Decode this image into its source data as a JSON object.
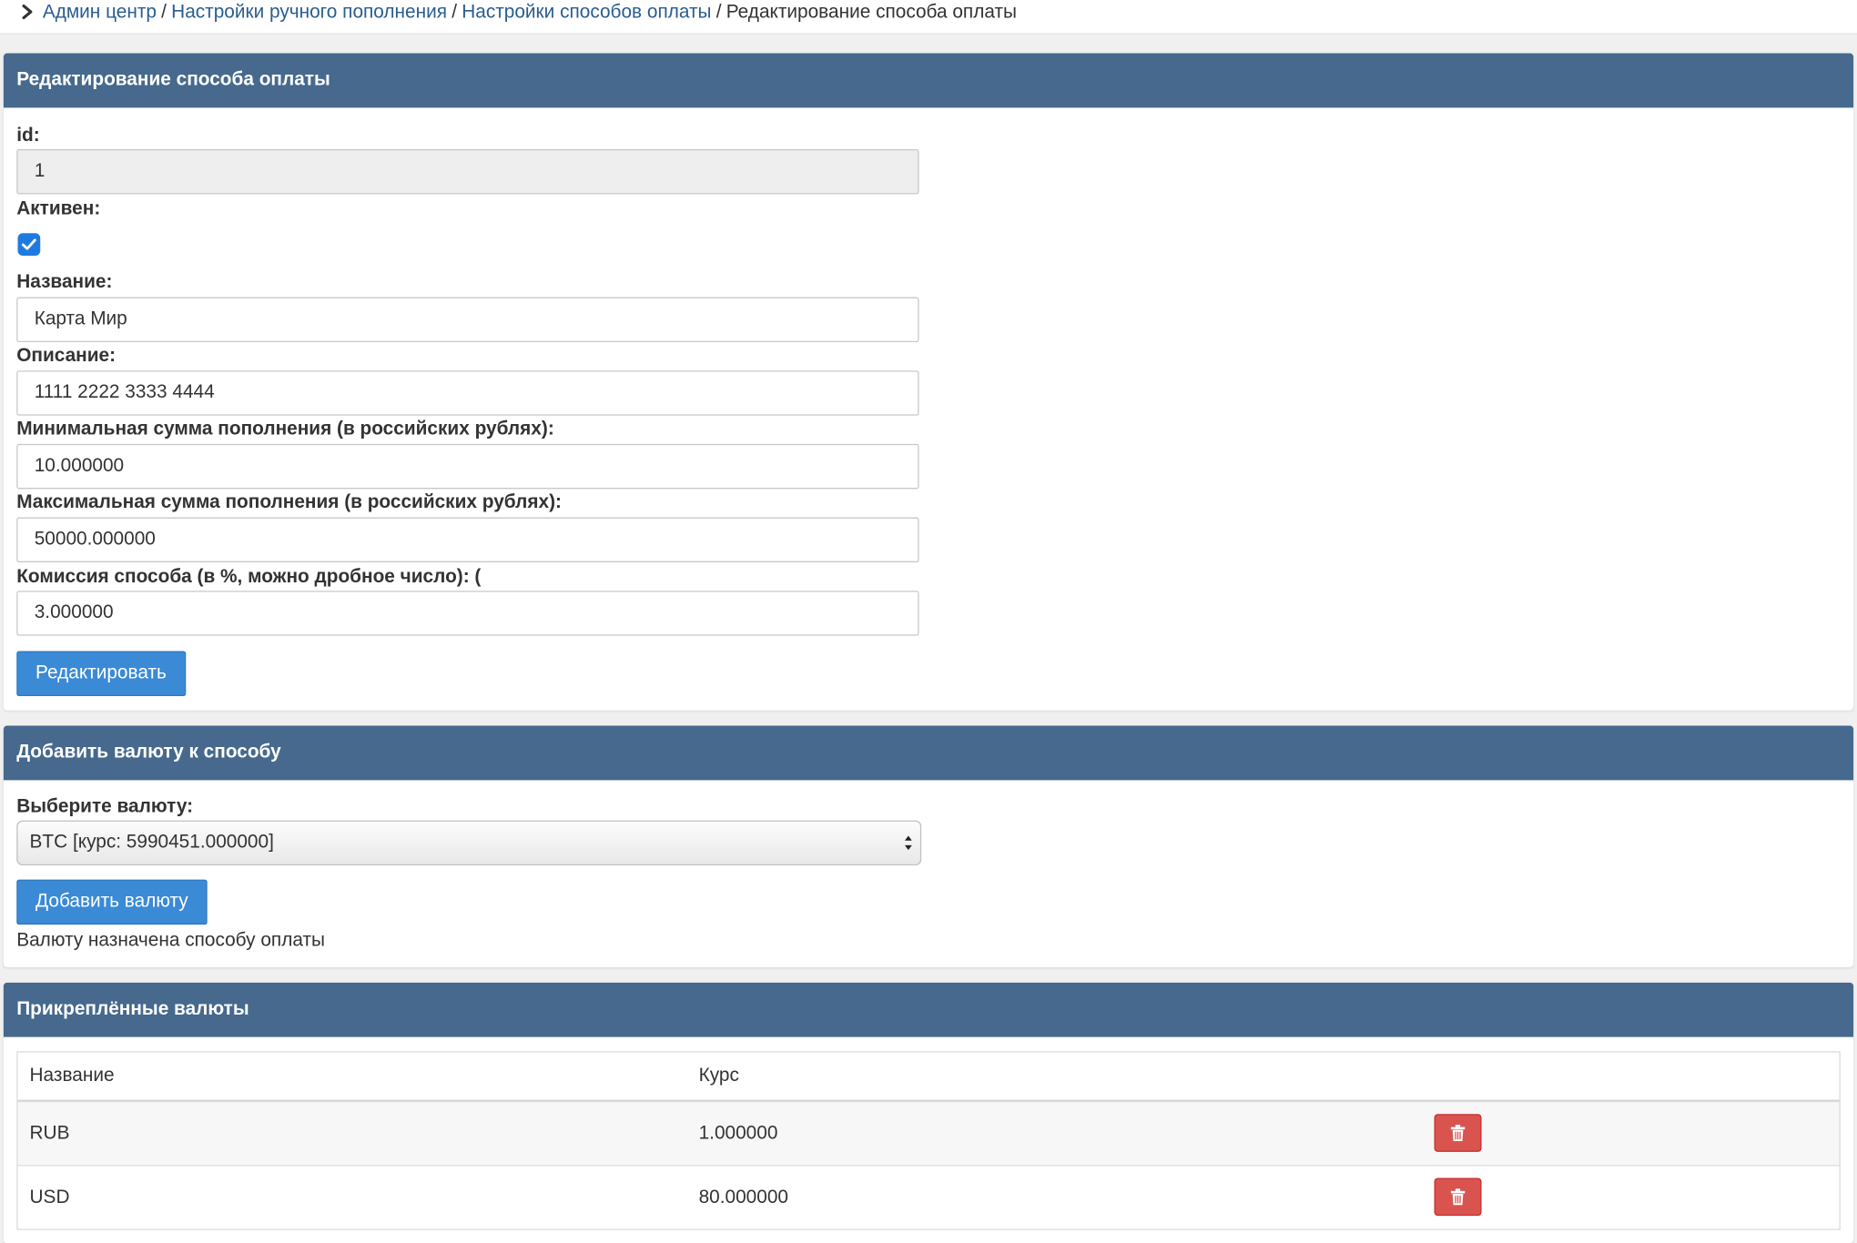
{
  "breadcrumb": {
    "items": [
      "Админ центр",
      "Настройки ручного пополнения",
      "Настройки способов оплаты"
    ],
    "separator": "/",
    "current": "Редактирование способа оплаты"
  },
  "edit_panel": {
    "title": "Редактирование способа оплаты",
    "id_label": "id:",
    "id_value": "1",
    "active_label": "Активен:",
    "active_checked": true,
    "name_label": "Название:",
    "name_value": "Карта Мир",
    "description_label": "Описание:",
    "description_value": "1111 2222 3333 4444",
    "min_label": "Минимальная сумма пополнения (в российских рублях):",
    "min_value": "10.000000",
    "max_label": "Максимальная сумма пополнения (в российских рублях):",
    "max_value": "50000.000000",
    "fee_label": "Комиссия способа (в %, можно дробное число): (",
    "fee_value": "3.000000",
    "submit_label": "Редактировать"
  },
  "add_currency_panel": {
    "title": "Добавить валюту к способу",
    "select_label": "Выберите валюту:",
    "selected_option": "BTC [курс: 5990451.000000]",
    "add_button_label": "Добавить валюту",
    "status_message": "Валюту назначена способу оплаты"
  },
  "attached_panel": {
    "title": "Прикреплённые валюты",
    "columns": [
      "Название",
      "Курс"
    ],
    "rows": [
      {
        "name": "RUB",
        "rate": "1.000000"
      },
      {
        "name": "USD",
        "rate": "80.000000"
      }
    ]
  },
  "colors": {
    "panel_header": "#46698d",
    "primary_button": "#3b8ad6",
    "danger_button": "#d9534f",
    "link": "#2a5d8f",
    "checkbox": "#1f7ae0"
  },
  "icons": [
    "chevron-right-icon",
    "checkmark-icon",
    "select-arrows-icon",
    "trash-icon"
  ]
}
